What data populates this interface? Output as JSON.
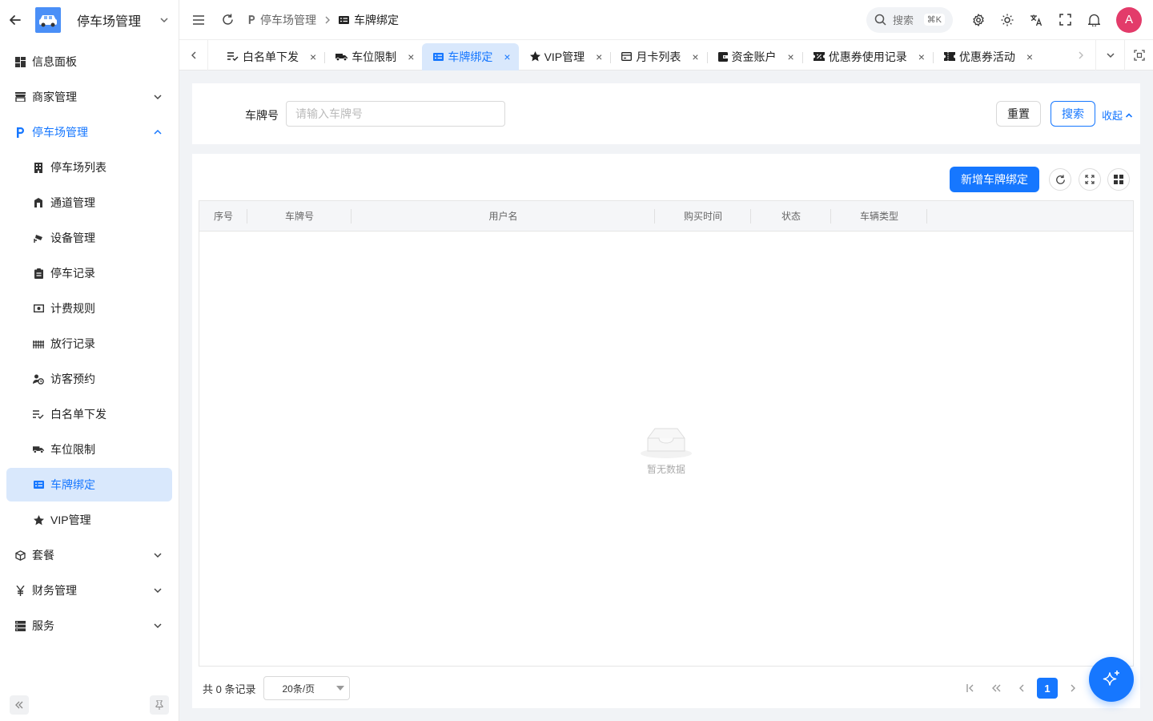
{
  "app": {
    "title": "停车场管理"
  },
  "sidebar": {
    "items": [
      {
        "label": "信息面板",
        "icon": "dashboard-icon"
      },
      {
        "label": "商家管理",
        "icon": "store-icon"
      },
      {
        "label": "停车场管理",
        "icon": "parking-icon",
        "expanded": true
      },
      {
        "label": "停车场列表",
        "icon": "building-icon"
      },
      {
        "label": "通道管理",
        "icon": "gate-icon"
      },
      {
        "label": "设备管理",
        "icon": "cctv-icon"
      },
      {
        "label": "停车记录",
        "icon": "clipboard-icon"
      },
      {
        "label": "计费规则",
        "icon": "cash-icon"
      },
      {
        "label": "放行记录",
        "icon": "barrier-icon"
      },
      {
        "label": "访客预约",
        "icon": "visitor-clock-icon"
      },
      {
        "label": "白名单下发",
        "icon": "list-check-icon"
      },
      {
        "label": "车位限制",
        "icon": "truck-icon"
      },
      {
        "label": "车牌绑定",
        "icon": "card-icon",
        "active": true
      },
      {
        "label": "VIP管理",
        "icon": "star-icon"
      },
      {
        "label": "套餐",
        "icon": "package-icon"
      },
      {
        "label": "财务管理",
        "icon": "yen-icon"
      },
      {
        "label": "服务",
        "icon": "server-icon"
      }
    ]
  },
  "header": {
    "breadcrumb": [
      "停车场管理",
      "车牌绑定"
    ],
    "search_label": "搜索",
    "search_shortcut": "⌘K",
    "avatar": "A"
  },
  "tabs": [
    {
      "label": "白名单下发"
    },
    {
      "label": "车位限制"
    },
    {
      "label": "车牌绑定",
      "active": true
    },
    {
      "label": "VIP管理"
    },
    {
      "label": "月卡列表"
    },
    {
      "label": "资金账户"
    },
    {
      "label": "优惠券使用记录"
    },
    {
      "label": "优惠券活动"
    }
  ],
  "filter": {
    "plate_label": "车牌号",
    "plate_placeholder": "请输入车牌号",
    "plate_value": "",
    "reset": "重置",
    "search": "搜索",
    "collapse": "收起"
  },
  "toolbar": {
    "add": "新增车牌绑定"
  },
  "table": {
    "columns": [
      "序号",
      "车牌号",
      "用户名",
      "购买时间",
      "状态",
      "车辆类型"
    ],
    "rows": [],
    "empty_text": "暂无数据"
  },
  "pagination": {
    "total": "共 0 条记录",
    "page_size": "20条/页",
    "current_page": "1"
  },
  "colors": {
    "primary": "#1677ff",
    "active_bg": "#d9e8fc",
    "avatar": "#e33b6a"
  }
}
